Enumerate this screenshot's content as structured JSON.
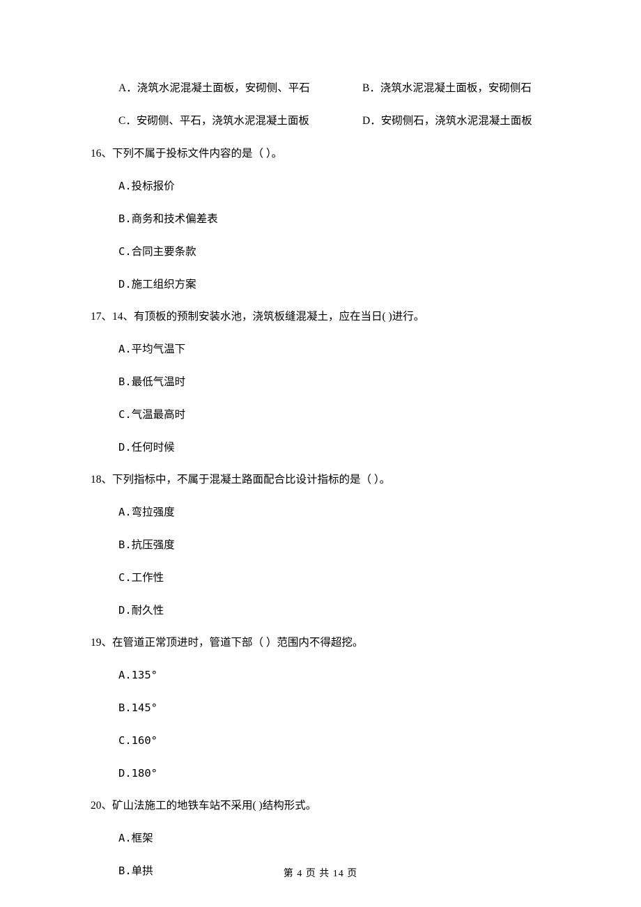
{
  "prev_opts": {
    "A": "A．浇筑水泥混凝土面板，安砌侧、平石",
    "B": "B．浇筑水泥混凝土面板，安砌侧石",
    "C": "C．安砌侧、平石，浇筑水泥混凝土面板",
    "D": "D．安砌侧石，浇筑水泥混凝土面板"
  },
  "questions": [
    {
      "stem": "16、下列不属于投标文件内容的是（  ）。",
      "opts": [
        "A.投标报价",
        "B.商务和技术偏差表",
        "C.合同主要条款",
        "D.施工组织方案"
      ]
    },
    {
      "stem": "17、14、有顶板的预制安装水池，浇筑板缝混凝土，应在当日(    )进行。",
      "opts": [
        "A.平均气温下",
        "B.最低气温时",
        "C.气温最高时",
        "D.任何时候"
      ]
    },
    {
      "stem": "18、下列指标中，不属于混凝土路面配合比设计指标的是（    ）。",
      "opts": [
        "A.弯拉强度",
        "B.抗压强度",
        "C.工作性",
        "D.耐久性"
      ]
    },
    {
      "stem": "19、在管道正常顶进时，管道下部（    ）范围内不得超挖。",
      "opts": [
        "A.135°",
        "B.145°",
        "C.160°",
        "D.180°"
      ]
    },
    {
      "stem": "20、矿山法施工的地铁车站不采用(    )结构形式。",
      "opts": [
        "A.框架",
        "B.单拱"
      ]
    }
  ],
  "footer": "第 4 页 共 14 页"
}
